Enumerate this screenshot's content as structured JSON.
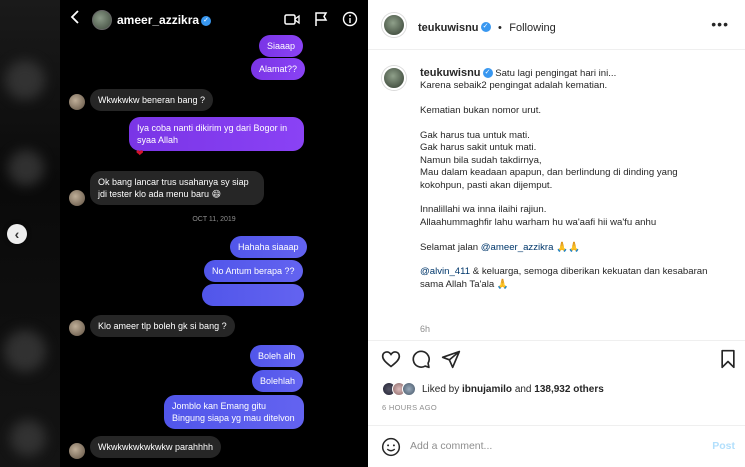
{
  "chat": {
    "username": "ameer_azzikra",
    "messages": [
      {
        "side": "me",
        "text": "Siaaap"
      },
      {
        "side": "me",
        "text": "Alamat??"
      },
      {
        "side": "them",
        "text": "Wkwkwkw beneran bang ?"
      },
      {
        "side": "me",
        "text": "Iya coba nanti dikirim yg dari Bogor in syaa Allah"
      },
      {
        "side": "them",
        "text": "Ok bang lancar trus usahanya sy siap jdi tester klo ada menu baru 😄"
      },
      {
        "side": "me",
        "text": "Hahaha siaaap"
      },
      {
        "side": "me",
        "text": "No Antum berapa ??"
      },
      {
        "side": "me",
        "text": ""
      },
      {
        "side": "them",
        "text": "Klo ameer tlp boleh gk si bang ?"
      },
      {
        "side": "me",
        "text": "Boleh alh"
      },
      {
        "side": "me",
        "text": "Bolehlah"
      },
      {
        "side": "me",
        "text": "Jomblo kan Emang gitu\nBingung siapa yg mau ditelvon"
      },
      {
        "side": "them",
        "text": "Wkwkwkwkwkwkw parahhhh"
      }
    ],
    "date_separator": "OCT 11, 2019",
    "heart": "❤"
  },
  "post": {
    "username": "teukuwisnu",
    "follow_label": "Following",
    "separator": "•",
    "caption_lines": [
      "Satu lagi pengingat hari ini...",
      "Karena sebaik2 pengingat adalah kematian.",
      "",
      "Kematian bukan nomor urut.",
      "",
      "Gak harus tua untuk mati.",
      "Gak harus sakit untuk mati.",
      "Namun bila sudah takdirnya,",
      "Mau dalam keadaan apapun, dan berlindung di dinding yang",
      "kokohpun, pasti akan dijemput.",
      "",
      "Innalillahi wa inna ilaihi rajiun.",
      "Allaahummaghfir lahu warham hu wa'aafi hii wa'fu anhu",
      "",
      "Selamat jalan ",
      "",
      "",
      "sama Allah Ta'ala 🙏"
    ],
    "farewell_mention": "@ameer_azzikra",
    "farewell_suffix": " 🙏🙏",
    "family_mention": "@alvin_411",
    "family_suffix": " & keluarga, semoga diberikan kekuatan dan kesabaran",
    "time_ago": "6h",
    "liked_prefix": "Liked by ",
    "liked_user": "ibnujamilo",
    "liked_and": " and ",
    "liked_count": "138,932 others",
    "posted_ago": "6 HOURS AGO",
    "comment_placeholder": "Add a comment...",
    "post_button": "Post"
  },
  "colors": {
    "accent_blue": "#3897f0",
    "message_purple": "#8a42f5",
    "message_blue": "#5c60ee"
  }
}
